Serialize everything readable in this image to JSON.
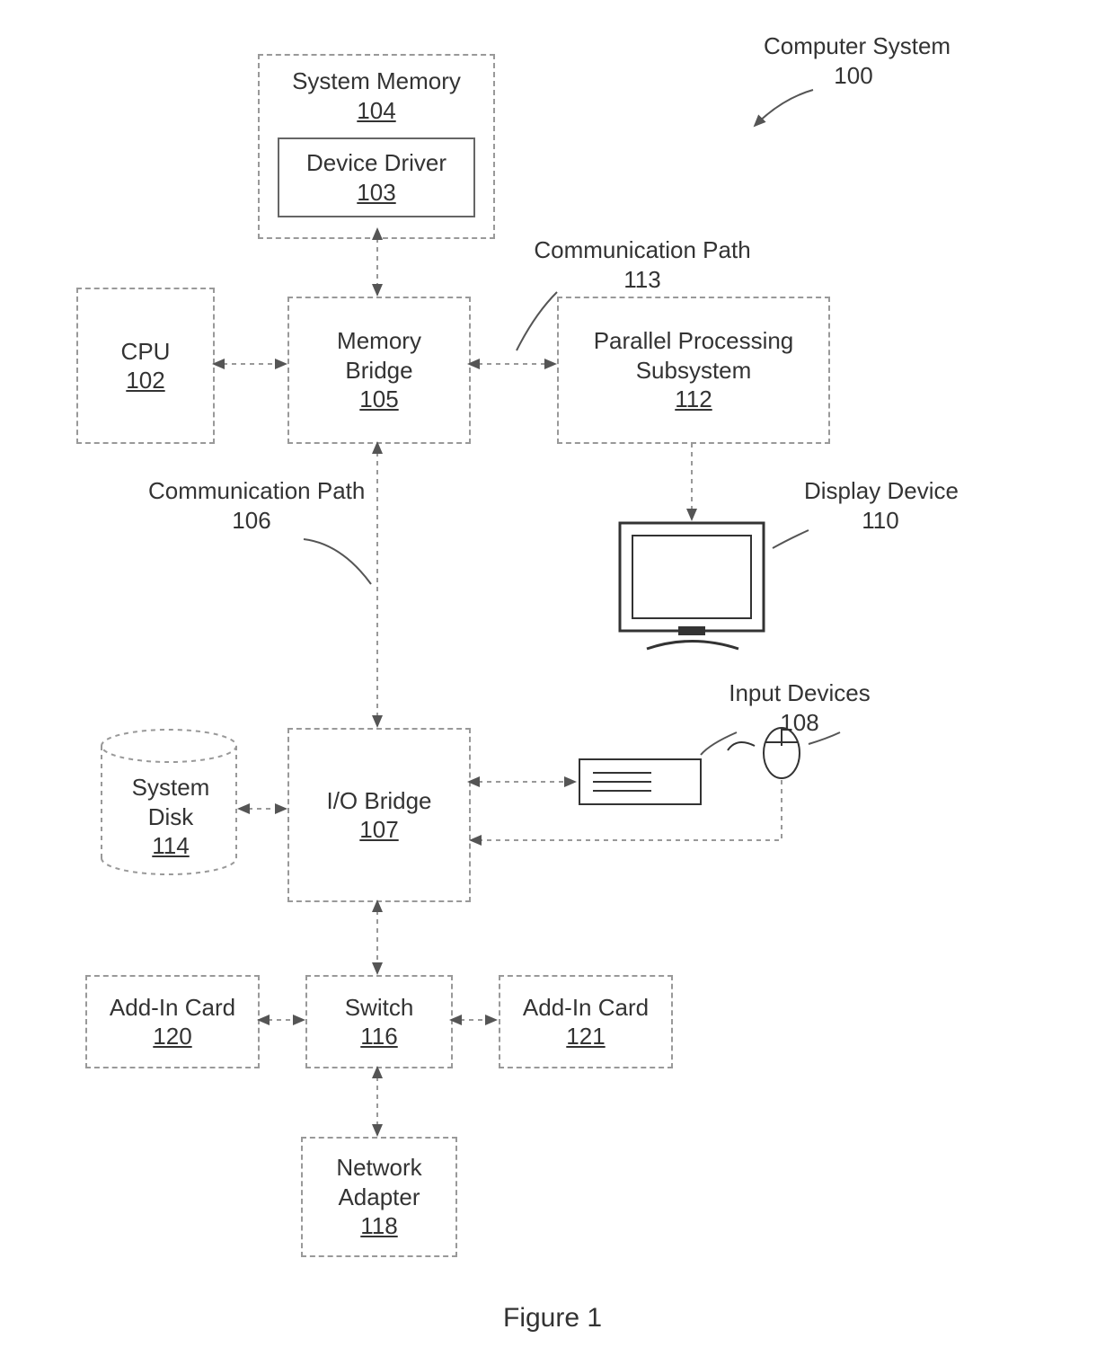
{
  "figure_caption": "Figure 1",
  "title": {
    "name": "Computer System",
    "num": "100"
  },
  "blocks": {
    "system_memory": {
      "name": "System Memory",
      "num": "104"
    },
    "device_driver": {
      "name": "Device Driver",
      "num": "103"
    },
    "cpu": {
      "name": "CPU",
      "num": "102"
    },
    "memory_bridge": {
      "name": "Memory Bridge",
      "num": "105"
    },
    "pps": {
      "name": "Parallel Processing Subsystem",
      "num": "112"
    },
    "io_bridge": {
      "name": "I/O Bridge",
      "num": "107"
    },
    "system_disk": {
      "name": "System Disk",
      "num": "114"
    },
    "switch": {
      "name": "Switch",
      "num": "116"
    },
    "addin_left": {
      "name": "Add-In Card",
      "num": "120"
    },
    "addin_right": {
      "name": "Add-In Card",
      "num": "121"
    },
    "network": {
      "name": "Network Adapter",
      "num": "118"
    }
  },
  "labels": {
    "comm_path_113": {
      "name": "Communication Path",
      "num": "113"
    },
    "comm_path_106": {
      "name": "Communication Path",
      "num": "106"
    },
    "display": {
      "name": "Display Device",
      "num": "110"
    },
    "input_devices": {
      "name": "Input Devices",
      "num": "108"
    }
  }
}
